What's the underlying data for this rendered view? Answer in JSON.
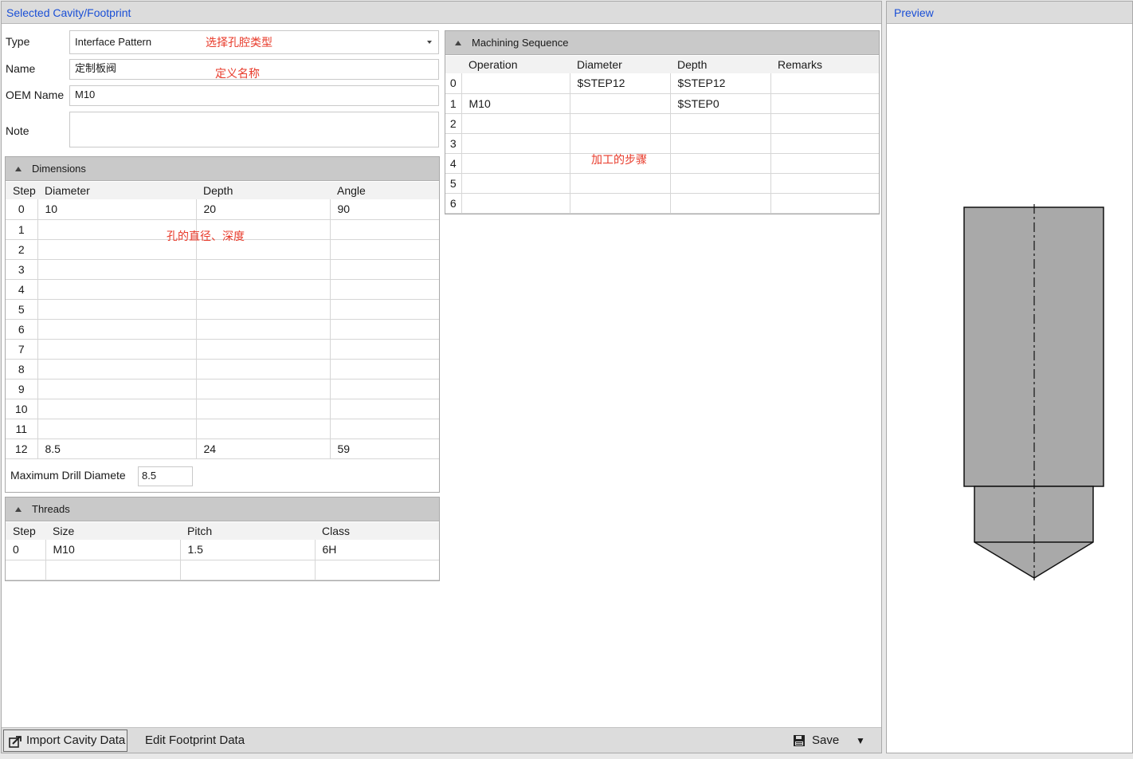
{
  "left_panel": {
    "title": "Selected Cavity/Footprint"
  },
  "form": {
    "type_label": "Type",
    "type_value": "Interface Pattern",
    "name_label": "Name",
    "name_value": "定制板阀",
    "oem_label": "OEM Name",
    "oem_value": "M10",
    "note_label": "Note",
    "note_value": ""
  },
  "annotations": {
    "type": "选择孔腔类型",
    "name": "定义名称",
    "dimensions": "孔的直径、深度",
    "machining": "加工的步骤"
  },
  "dimensions": {
    "title": "Dimensions",
    "headers": [
      "Step",
      "Diameter",
      "Depth",
      "Angle"
    ],
    "rows": [
      [
        "0",
        "10",
        "20",
        "90"
      ],
      [
        "1",
        "",
        "",
        ""
      ],
      [
        "2",
        "",
        "",
        ""
      ],
      [
        "3",
        "",
        "",
        ""
      ],
      [
        "4",
        "",
        "",
        ""
      ],
      [
        "5",
        "",
        "",
        ""
      ],
      [
        "6",
        "",
        "",
        ""
      ],
      [
        "7",
        "",
        "",
        ""
      ],
      [
        "8",
        "",
        "",
        ""
      ],
      [
        "9",
        "",
        "",
        ""
      ],
      [
        "10",
        "",
        "",
        ""
      ],
      [
        "11",
        "",
        "",
        ""
      ],
      [
        "12",
        "8.5",
        "24",
        "59"
      ]
    ],
    "max_drill_label": "Maximum Drill Diamete",
    "max_drill_value": "8.5"
  },
  "threads": {
    "title": "Threads",
    "headers": [
      "Step",
      "Size",
      "Pitch",
      "Class"
    ],
    "rows": [
      [
        "0",
        "M10",
        "1.5",
        "6H"
      ],
      [
        "",
        "",
        "",
        ""
      ]
    ]
  },
  "machining": {
    "title": "Machining Sequence",
    "headers": [
      "",
      "Operation",
      "Diameter",
      "Depth",
      "Remarks"
    ],
    "rows": [
      [
        "0",
        "",
        "$STEP12",
        "$STEP12",
        ""
      ],
      [
        "1",
        "M10",
        "",
        "$STEP0",
        ""
      ],
      [
        "2",
        "",
        "",
        "",
        ""
      ],
      [
        "3",
        "",
        "",
        "",
        ""
      ],
      [
        "4",
        "",
        "",
        "",
        ""
      ],
      [
        "5",
        "",
        "",
        "",
        ""
      ],
      [
        "6",
        "",
        "",
        "",
        ""
      ]
    ]
  },
  "bottom_bar": {
    "import_label": "Import Cavity Data",
    "edit_label": "Edit Footprint Data",
    "save_label": "Save",
    "dropdown_glyph": "▼"
  },
  "preview": {
    "title": "Preview"
  },
  "colors": {
    "title_blue": "#1a4fd6",
    "annotation_red": "#e83a2a",
    "shape_fill": "#a9a9a9"
  },
  "icons": {
    "import": "import-icon",
    "save": "floppy-disk-icon",
    "collapse": "triangle-up-icon",
    "dropdown": "chevron-down-icon"
  }
}
